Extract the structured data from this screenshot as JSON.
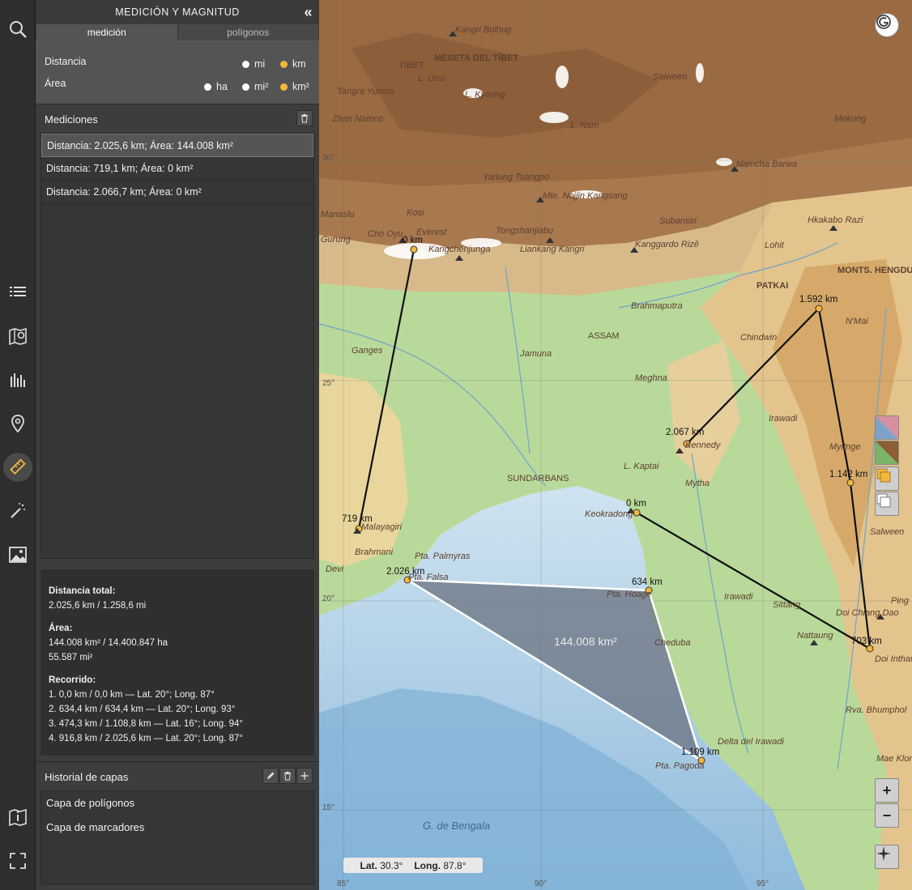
{
  "panel": {
    "title": "MEDICIÓN Y MAGNITUD",
    "tabs": [
      "medición",
      "polígonos"
    ],
    "units": {
      "distance_label": "Distancia",
      "area_label": "Área",
      "distance_options": [
        "mi",
        "km"
      ],
      "area_options": [
        "ha",
        "mi²",
        "km²"
      ],
      "selected_distance": "km",
      "selected_area": "km²"
    },
    "measurements_title": "Mediciones",
    "measurements": [
      "Distancia: 2.025,6 km; Área: 144.008 km²",
      "Distancia: 719,1 km; Área: 0 km²",
      "Distancia: 2.066,7 km; Área: 0 km²"
    ],
    "summary": {
      "total_label": "Distancia total:",
      "total_value": "2.025,6 km / 1.258,6 mi",
      "area_label": "Área:",
      "area_value_1": "144.008 km² / 14.400.847 ha",
      "area_value_2": "55.587 mi²",
      "route_label": "Recorrido:",
      "route": [
        "1. 0,0 km / 0,0 km — Lat. 20°; Long. 87°",
        "2. 634,4 km / 634,4 km — Lat. 20°; Long. 93°",
        "3. 474,3 km / 1.108,8 km — Lat. 16°; Long. 94°",
        "4. 916,8 km / 2.025,6 km — Lat. 20°; Long. 87°"
      ]
    },
    "history_title": "Historial de capas",
    "history": [
      "Capa de polígonos",
      "Capa de marcadores"
    ]
  },
  "map": {
    "polygon_area": "144.008 km²",
    "coords_lat_label": "Lat.",
    "coords_lat": "30.3°",
    "coords_long_label": "Long.",
    "coords_long": "87.8°",
    "zoom_in": "+",
    "zoom_out": "−",
    "lat_ticks": [
      "30°",
      "25°",
      "20°",
      "15°"
    ],
    "long_ticks": [
      "85°",
      "90°",
      "95°"
    ],
    "measure_labels": [
      "0 km",
      "719 km",
      "2.026 km",
      "634 km",
      "1.109 km",
      "0 km",
      "703 km",
      "1.142 km",
      "1.592 km",
      "2.067 km"
    ],
    "place_names": [
      "Kangri Bolhug",
      "MESETA DEL TÍBET",
      "TÍBET",
      "L. Urru",
      "Tangra Yumco",
      "L. Kyaring",
      "Zhari Namco",
      "L. Nam",
      "Salween",
      "Namcha Barwa",
      "Mekong",
      "Yarlung Tsangpo",
      "Mte. Nojjin Kangsang",
      "Manaslu",
      "Kosi",
      "Everest",
      "Cho Oyu",
      "Gurung",
      "Kangchenjunga",
      "Tongshanjiabu",
      "Liankang Kangri",
      "Kanggardo Rizê",
      "Subansiri",
      "Hkakabo Razi",
      "Lohit",
      "MONTS. HENGDUAN",
      "PATKAI",
      "Brahmaputra",
      "ASSAM",
      "Ganges",
      "Jamuna",
      "Chindwin",
      "N'Mai",
      "Meghna",
      "Irawadi",
      "Kennedy",
      "Myitnge",
      "Malayagiri",
      "SUNDARBANS",
      "L. Kaptai",
      "Keokradong",
      "Mytha",
      "Salween",
      "Brahmani",
      "Pta. Palmyras",
      "Pta. Falsa",
      "Devi",
      "Pta. Hoage",
      "Cheduba",
      "Sittang",
      "Irawadi",
      "Doi Chiang Dao",
      "Nattaung",
      "Ping",
      "Doi Inthanon",
      "Rva. Bhumphol",
      "Delta del Irawadi",
      "Pta. Pagoda",
      "Mae Klong",
      "G. de Bengala"
    ]
  },
  "colors": {
    "accent": "#f2b83b",
    "panel": "#3d3d3d",
    "rail": "#2e2e2e"
  }
}
